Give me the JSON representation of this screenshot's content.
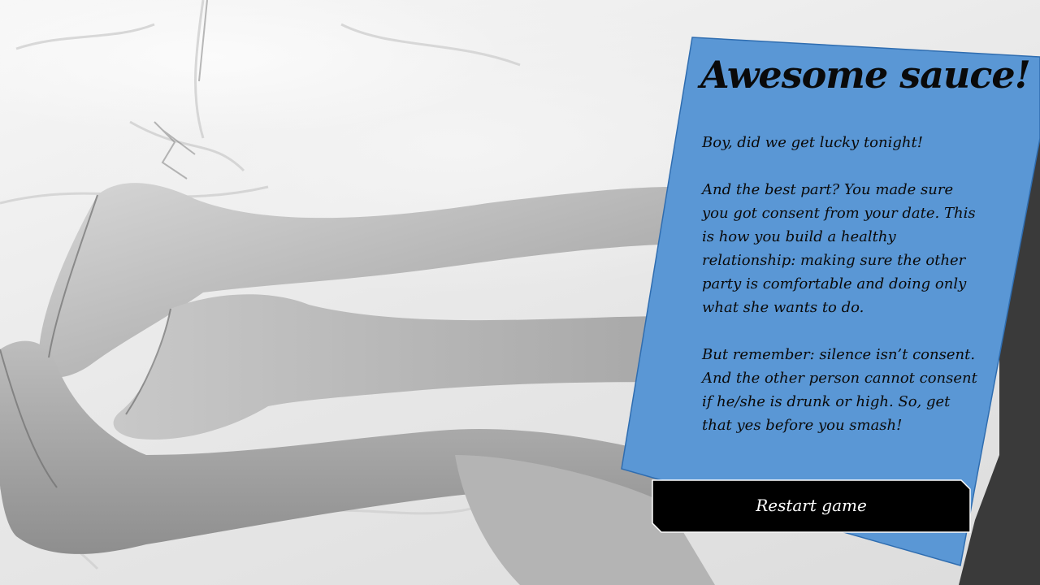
{
  "scene": {
    "image_description": "black-and-white-photo-of-legs-on-bed"
  },
  "card": {
    "title": "Awesome sauce!",
    "paragraphs": [
      "Boy, did we get lucky tonight!",
      "And the best part? You made sure you got consent from your date. This is how you build a healthy relationship: making sure the other party is comfortable and doing only what she wants to do.",
      "But remember: silence isn’t consent. And the other person cannot consent if he/she is drunk or high. So, get that yes before you smash!"
    ],
    "background_color": "#5a97d5"
  },
  "restart_button": {
    "label": "Restart game",
    "background_color": "#000000",
    "border_color": "#ffffff"
  }
}
